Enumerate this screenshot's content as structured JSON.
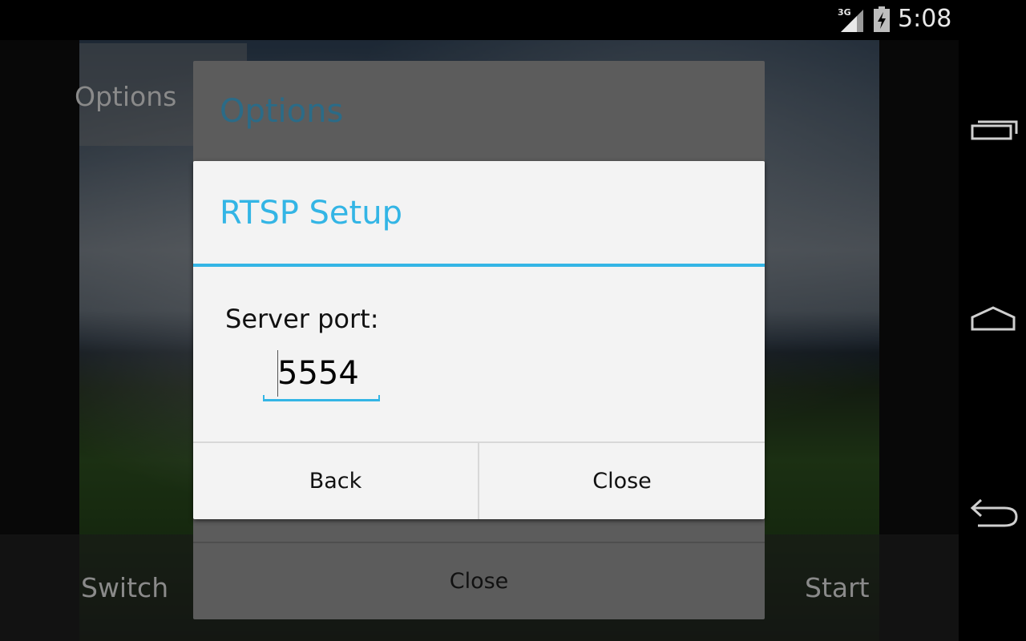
{
  "status_bar": {
    "network": "3G",
    "time": "5:08"
  },
  "background": {
    "options_label": "Options",
    "switch_label": "Switch",
    "start_label": "Start"
  },
  "options_dialog": {
    "title": "Options",
    "close_label": "Close"
  },
  "rtsp_dialog": {
    "title": "RTSP Setup",
    "port_label": "Server port:",
    "port_value": "5554",
    "back_label": "Back",
    "close_label": "Close"
  },
  "colors": {
    "accent": "#33b5e5",
    "dim_title": "#2b6b87"
  },
  "icons": {
    "signal": "signal-3g-icon",
    "battery": "battery-charging-icon",
    "recents": "recent-apps-icon",
    "home": "home-icon",
    "back": "back-icon"
  }
}
